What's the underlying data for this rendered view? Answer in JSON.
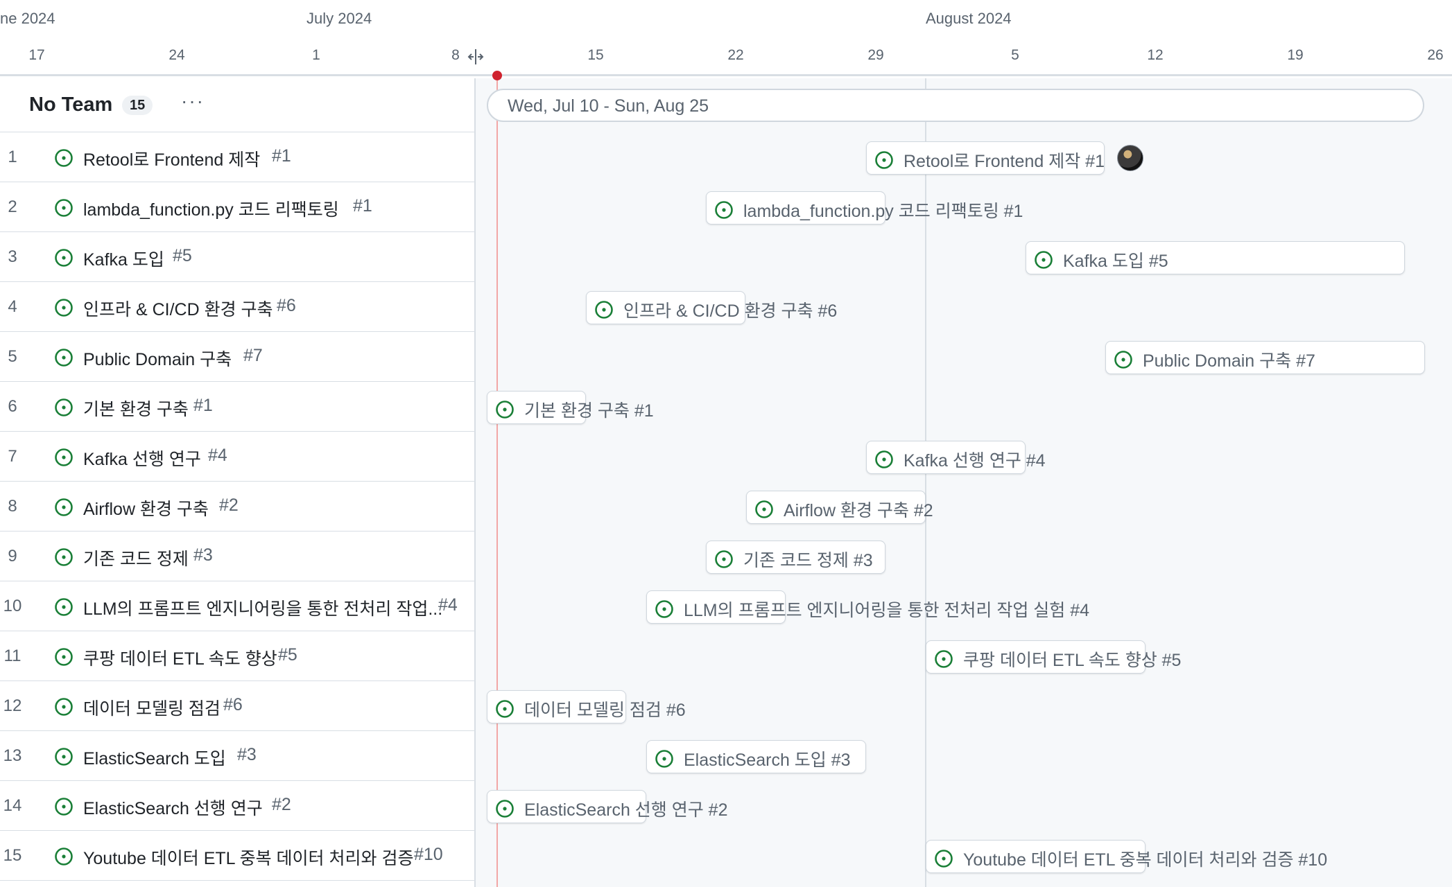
{
  "timeline": {
    "months": [
      "ne 2024",
      "July 2024",
      "August 2024"
    ],
    "days": [
      "17",
      "24",
      "1",
      "8",
      "15",
      "22",
      "29",
      "5",
      "12",
      "19",
      "26"
    ]
  },
  "group": {
    "title": "No Team",
    "count": "15",
    "menu": "···",
    "date_range": "Wed, Jul 10 - Sun, Aug 25"
  },
  "rows": [
    {
      "num": "1",
      "title": "Retool로 Frontend 제작",
      "issue": "#1",
      "bar_label": "Retool로 Frontend 제작 #1"
    },
    {
      "num": "2",
      "title": "lambda_function.py 코드 리팩토링",
      "issue": "#1",
      "bar_label": "lambda_function.py 코드 리팩토링 #1"
    },
    {
      "num": "3",
      "title": "Kafka 도입",
      "issue": "#5",
      "bar_label": "Kafka 도입 #5"
    },
    {
      "num": "4",
      "title": "인프라 & CI/CD 환경 구축",
      "issue": "#6",
      "bar_label": "인프라 & CI/CD 환경 구축 #6"
    },
    {
      "num": "5",
      "title": "Public Domain 구축",
      "issue": "#7",
      "bar_label": "Public Domain 구축 #7"
    },
    {
      "num": "6",
      "title": "기본 환경 구축",
      "issue": "#1",
      "bar_label": "기본 환경 구축 #1"
    },
    {
      "num": "7",
      "title": "Kafka 선행 연구",
      "issue": "#4",
      "bar_label": "Kafka 선행 연구 #4"
    },
    {
      "num": "8",
      "title": "Airflow 환경 구축",
      "issue": "#2",
      "bar_label": "Airflow 환경 구축 #2"
    },
    {
      "num": "9",
      "title": "기존 코드 정제",
      "issue": "#3",
      "bar_label": "기존 코드 정제 #3"
    },
    {
      "num": "10",
      "title": "LLM의 프롬프트 엔지니어링을 통한 전처리 작업...",
      "issue": "#4",
      "bar_label": "LLM의 프롬프트 엔지니어링을 통한 전처리 작업 실험 #4"
    },
    {
      "num": "11",
      "title": "쿠팡 데이터 ETL 속도 향상",
      "issue": "#5",
      "bar_label": "쿠팡 데이터 ETL 속도 향상 #5"
    },
    {
      "num": "12",
      "title": "데이터 모델링 점검",
      "issue": "#6",
      "bar_label": "데이터 모델링 점검 #6"
    },
    {
      "num": "13",
      "title": "ElasticSearch 도입",
      "issue": "#3",
      "bar_label": "ElasticSearch 도입 #3"
    },
    {
      "num": "14",
      "title": "ElasticSearch 선행 연구",
      "issue": "#2",
      "bar_label": "ElasticSearch 선행 연구 #2"
    },
    {
      "num": "15",
      "title": "Youtube 데이터 ETL 중복 데이터 처리와 검증",
      "issue": "#10",
      "bar_label": "Youtube 데이터 ETL 중복 데이터 처리와 검증 #10"
    }
  ],
  "colors": {
    "issue_open": "#1a7f37",
    "today_marker": "#cf222e"
  },
  "icons": {
    "issue": "issue-opened-icon",
    "resize": "column-resize-icon",
    "menu": "kebab-horizontal-icon"
  }
}
